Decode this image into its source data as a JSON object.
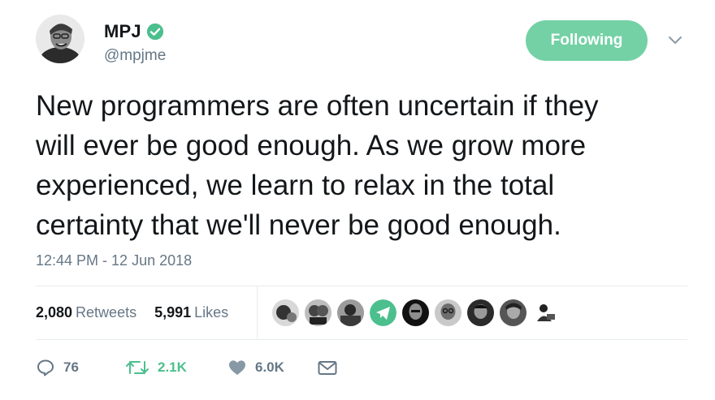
{
  "author": {
    "display_name": "MPJ",
    "handle": "@mpjme",
    "verified": true
  },
  "follow_button": {
    "label": "Following",
    "color": "#74d1a5"
  },
  "tweet": {
    "lines": [
      "New programmers are often uncertain if they",
      "will ever be good enough. As we grow more",
      "experienced, we learn to relax in the total",
      "certainty that we'll never be good enough."
    ],
    "timestamp": "12:44 PM - 12 Jun 2018"
  },
  "stats": {
    "retweets_count": "2,080",
    "retweets_label": "Retweets",
    "likes_count": "5,991",
    "likes_label": "Likes"
  },
  "likers": [
    "avatar-1",
    "avatar-2",
    "avatar-3",
    "avatar-telegram",
    "avatar-5",
    "avatar-6",
    "avatar-7",
    "avatar-8",
    "avatar-9"
  ],
  "actions": {
    "reply_count": "76",
    "retweet_count": "2.1K",
    "like_count": "6.0K"
  },
  "icons": {
    "verified": "verified-badge-icon",
    "caret": "chevron-down-icon",
    "reply": "reply-icon",
    "retweet": "retweet-icon",
    "like": "heart-icon",
    "dm": "envelope-icon"
  },
  "colors": {
    "accent_green": "#74d1a5",
    "verified_green": "#4cbf8e",
    "text_secondary": "#657786"
  }
}
